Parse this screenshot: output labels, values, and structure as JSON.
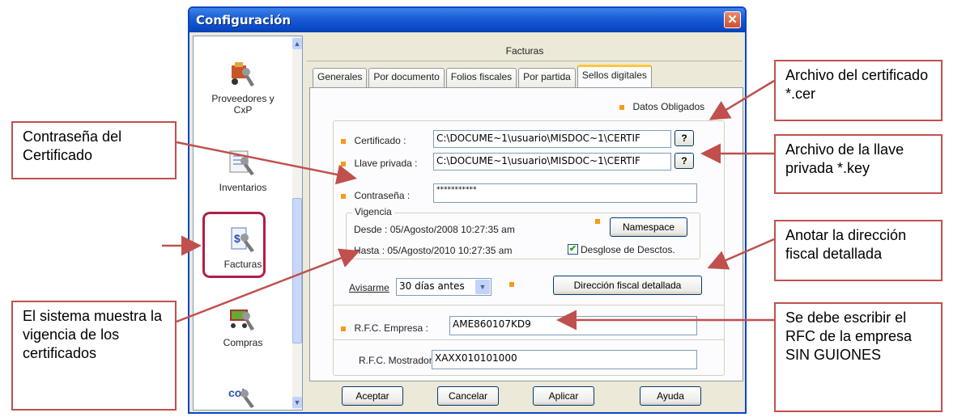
{
  "window": {
    "title": "Configuración",
    "close_glyph": "✕"
  },
  "sidebar": {
    "items": [
      {
        "label": "Proveedores y CxP",
        "icon": "truck-wrench-icon"
      },
      {
        "label": "Inventarios",
        "icon": "inventory-wrench-icon"
      },
      {
        "label": "Facturas",
        "icon": "invoice-wrench-icon",
        "selected": true
      },
      {
        "label": "Compras",
        "icon": "cart-wrench-icon"
      },
      {
        "label": "",
        "icon": "col-wrench-icon"
      }
    ]
  },
  "panel": {
    "title": "Facturas",
    "tabs": [
      "Generales",
      "Por documento",
      "Folios fiscales",
      "Por partida",
      "Sellos digitales"
    ],
    "active_tab": "Sellos digitales",
    "required_legend": "Datos Obligados",
    "certificado_label": "Certificado :",
    "certificado_value": "C:\\DOCUME~1\\usuario\\MISDOC~1\\CERTIF",
    "llave_label": "Llave privada :",
    "llave_value": "C:\\DOCUME~1\\usuario\\MISDOC~1\\CERTIF",
    "browse_label": "?",
    "password_label": "Contraseña :",
    "password_value": "***********",
    "vigencia_title": "Vigencia",
    "desde": "Desde : 05/Agosto/2008 10:27:35 am",
    "hasta": "Hasta : 05/Agosto/2010 10:27:35 am",
    "namespace_button": "Namespace",
    "desglose_label": "Desglose de Desctos.",
    "desglose_checked": true,
    "avisarme_label": "Avisarme",
    "avisarme_value": "30 días antes",
    "direccion_button": "Dirección fiscal detallada",
    "rfc_empresa_label": "R.F.C. Empresa :",
    "rfc_empresa_value": "AME860107KD9",
    "rfc_mostrador_label": "R.F.C. Mostrador :",
    "rfc_mostrador_value": "XAXX010101000"
  },
  "buttons": {
    "aceptar": "Aceptar",
    "cancelar": "Cancelar",
    "aplicar": "Aplicar",
    "ayuda": "Ayuda"
  },
  "callouts": {
    "contrasena": "Contraseña del Certificado",
    "vigencia": "El sistema muestra la vigencia de los certificados",
    "archivo_cer": "Archivo del certificado *.cer",
    "archivo_key": "Archivo de la llave privada *.key",
    "direccion": "Anotar la dirección fiscal detallada",
    "rfc": "Se debe escribir el RFC de la empresa SIN GUIONES"
  },
  "colors": {
    "callout_border": "#c0504d",
    "accent": "#f59a19",
    "titlebar": "#0a4bc9"
  }
}
